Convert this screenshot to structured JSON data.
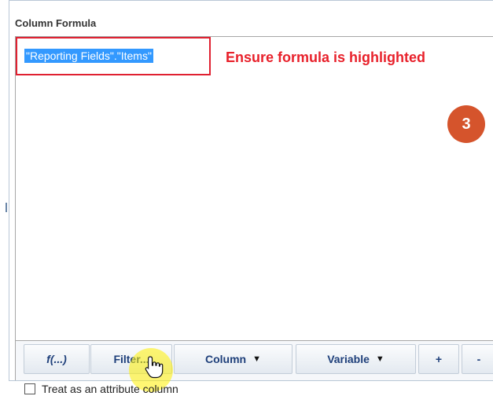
{
  "panel": {
    "title": "Column Formula"
  },
  "editor": {
    "formula": "\"Reporting Fields\".\"Items\"",
    "callout": "Ensure formula is highlighted",
    "step_number": "3"
  },
  "toolbar": {
    "buttons": [
      {
        "label": "f(...)"
      },
      {
        "label": "Filter..."
      },
      {
        "label": "Column",
        "has_dropdown": true
      },
      {
        "label": "Variable",
        "has_dropdown": true
      },
      {
        "label": "+"
      },
      {
        "label": "-"
      }
    ]
  },
  "attribute": {
    "label": "Treat as an attribute column",
    "checked": false
  },
  "colors": {
    "highlight_red": "#e8212b",
    "step_orange": "#d5542c",
    "selection_blue": "#3399ff",
    "cursor_highlight": "#fff000"
  },
  "icons": {
    "dropdown": "caret-down-icon",
    "cursor": "hand-pointer-icon"
  }
}
